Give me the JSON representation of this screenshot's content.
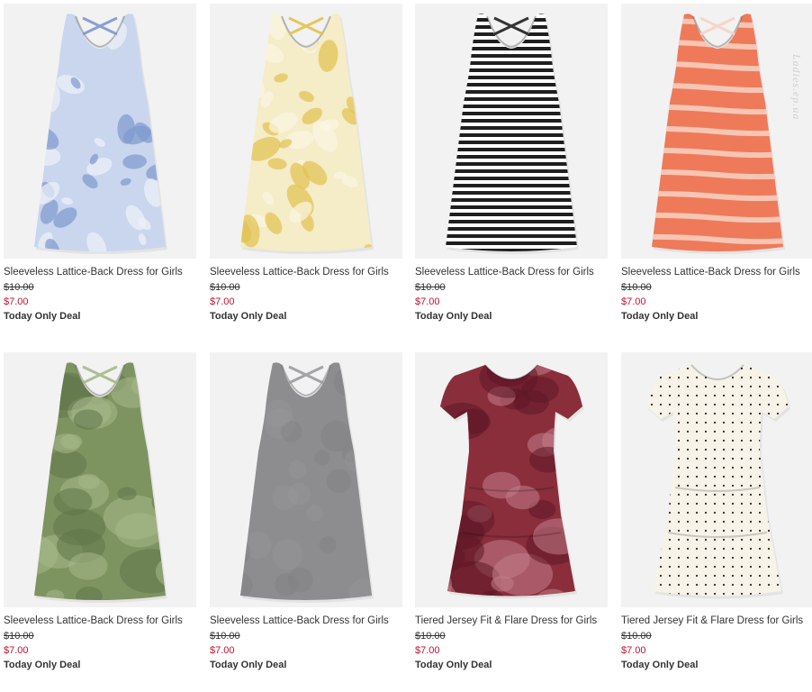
{
  "watermark": "Ladies.ep.ua",
  "products": [
    {
      "name": "Sleeveless Lattice-Back Dress for Girls",
      "was": "$10.00",
      "now": "$7.00",
      "deal": "Today Only Deal",
      "style": "tank",
      "pattern": "floral",
      "colors": {
        "base": "#c9d6ee",
        "accent": "#7d98cf",
        "accent2": "#eef2fa"
      }
    },
    {
      "name": "Sleeveless Lattice-Back Dress for Girls",
      "was": "$10.00",
      "now": "$7.00",
      "deal": "Today Only Deal",
      "style": "tank",
      "pattern": "floral",
      "colors": {
        "base": "#f5ecc8",
        "accent": "#e3c24e",
        "accent2": "#fbf6e4"
      }
    },
    {
      "name": "Sleeveless Lattice-Back Dress for Girls",
      "was": "$10.00",
      "now": "$7.00",
      "deal": "Today Only Deal",
      "style": "tank",
      "pattern": "stripes",
      "colors": {
        "base": "#ffffff",
        "accent": "#1f1f1f",
        "accent2": "#ffffff"
      }
    },
    {
      "name": "Sleeveless Lattice-Back Dress for Girls",
      "was": "$10.00",
      "now": "$7.00",
      "deal": "Today Only Deal",
      "style": "tank",
      "pattern": "tiestripes",
      "colors": {
        "base": "#ee7a5a",
        "accent": "#f8d2c4",
        "accent2": "#ee7a5a"
      }
    },
    {
      "name": "Sleeveless Lattice-Back Dress for Girls",
      "was": "$10.00",
      "now": "$7.00",
      "deal": "Today Only Deal",
      "style": "tank",
      "pattern": "tiedye",
      "colors": {
        "base": "#7e9460",
        "accent": "#a6b88b",
        "accent2": "#5f7548"
      }
    },
    {
      "name": "Sleeveless Lattice-Back Dress for Girls",
      "was": "$10.00",
      "now": "$7.00",
      "deal": "Today Only Deal",
      "style": "tank",
      "pattern": "solid",
      "colors": {
        "base": "#8d8d90",
        "accent": "#9b9b9e",
        "accent2": "#7e7e81"
      }
    },
    {
      "name": "Tiered Jersey Fit & Flare Dress for Girls",
      "was": "$10.00",
      "now": "$7.00",
      "deal": "Today Only Deal",
      "style": "tiered",
      "pattern": "tiedye",
      "colors": {
        "base": "#8a2e3c",
        "accent": "#c27e8a",
        "accent2": "#5e1826"
      }
    },
    {
      "name": "Tiered Jersey Fit & Flare Dress for Girls",
      "was": "$10.00",
      "now": "$7.00",
      "deal": "Today Only Deal",
      "style": "tiered",
      "pattern": "dots",
      "colors": {
        "base": "#f7f3e8",
        "accent": "#2a2a2a",
        "accent2": "#efe9da"
      }
    }
  ]
}
